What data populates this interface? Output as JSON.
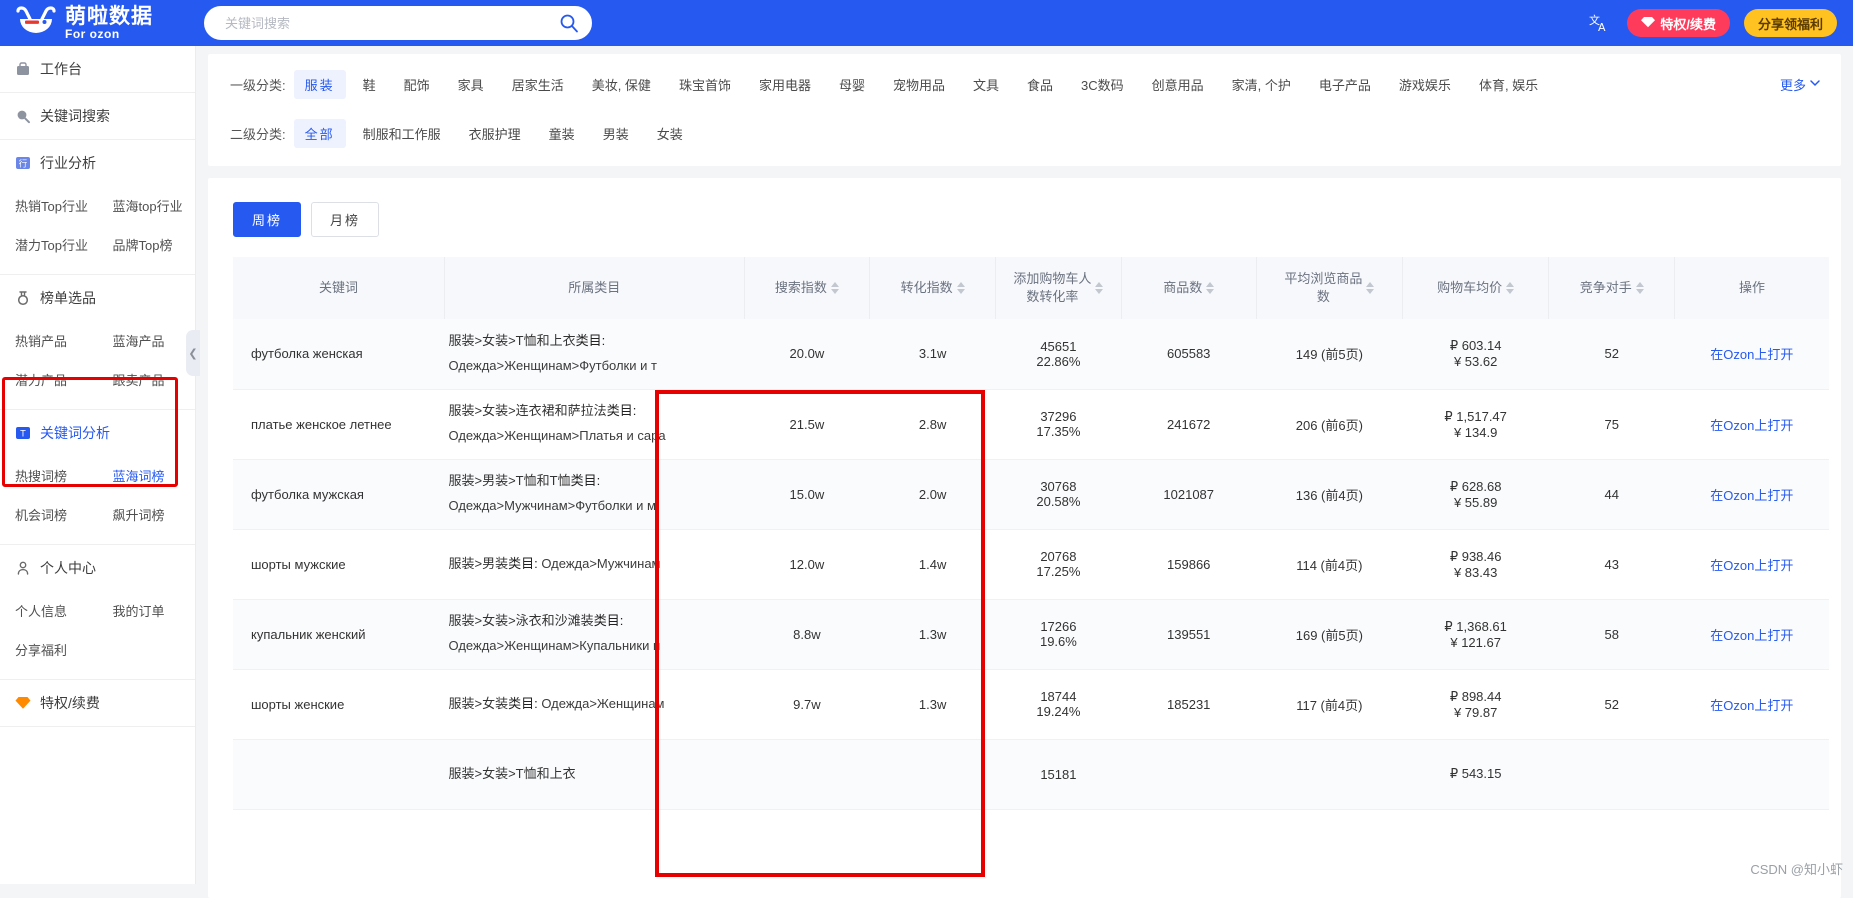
{
  "brand": {
    "name": "萌啦数据",
    "sub": "For ozon",
    "logo_icon": "smiley-logo-icon"
  },
  "search": {
    "placeholder": "关键词搜索",
    "value": "",
    "icon": "search-icon"
  },
  "topbar": {
    "lang_icon": "language-icon",
    "privilege_label": "特权/续费",
    "privilege_icon": "diamond-icon",
    "share_label": "分享领福利"
  },
  "sidebar": {
    "groups": [
      {
        "icon": "workbench-icon",
        "label": "工作台",
        "active": false,
        "items": []
      },
      {
        "icon": "search-icon",
        "label": "关键词搜索",
        "active": false,
        "items": []
      },
      {
        "icon": "industry-icon",
        "label": "行业分析",
        "active": false,
        "items": [
          {
            "label": "热销Top行业",
            "on": false
          },
          {
            "label": "蓝海top行业",
            "on": false
          },
          {
            "label": "潜力Top行业",
            "on": false
          },
          {
            "label": "品牌Top榜",
            "on": false
          }
        ]
      },
      {
        "icon": "medal-icon",
        "label": "榜单选品",
        "active": false,
        "items": [
          {
            "label": "热销产品",
            "on": false
          },
          {
            "label": "蓝海产品",
            "on": false
          },
          {
            "label": "潜力产品",
            "on": false
          },
          {
            "label": "跟卖产品",
            "on": false
          }
        ]
      },
      {
        "icon": "keyword-icon",
        "label": "关键词分析",
        "active": true,
        "items": [
          {
            "label": "热搜词榜",
            "on": false
          },
          {
            "label": "蓝海词榜",
            "on": true
          },
          {
            "label": "机会词榜",
            "on": false
          },
          {
            "label": "飙升词榜",
            "on": false
          }
        ]
      },
      {
        "icon": "user-icon",
        "label": "个人中心",
        "active": false,
        "items": [
          {
            "label": "个人信息",
            "on": false
          },
          {
            "label": "我的订单",
            "on": false
          },
          {
            "label": "分享福利",
            "on": false
          }
        ]
      },
      {
        "icon": "privilege-icon",
        "label": "特权/续费",
        "active": false,
        "items": []
      }
    ],
    "collapse_icon": "chevron-left-icon"
  },
  "filters": {
    "level1": {
      "label": "一级分类:",
      "selected": "服装",
      "options": [
        "服装",
        "鞋",
        "配饰",
        "家具",
        "居家生活",
        "美妆, 保健",
        "珠宝首饰",
        "家用电器",
        "母婴",
        "宠物用品",
        "文具",
        "食品",
        "3C数码",
        "创意用品",
        "家清, 个护",
        "电子产品",
        "游戏娱乐",
        "体育, 娱乐"
      ],
      "more_label": "更多",
      "more_icon": "chevron-down-icon"
    },
    "level2": {
      "label": "二级分类:",
      "selected": "全部",
      "options": [
        "全部",
        "制服和工作服",
        "衣服护理",
        "童装",
        "男装",
        "女装"
      ]
    }
  },
  "table": {
    "tabs": [
      {
        "label": "周榜",
        "active": true
      },
      {
        "label": "月榜",
        "active": false
      }
    ],
    "columns": [
      {
        "label": "关键词",
        "sortable": false
      },
      {
        "label": "所属类目",
        "sortable": false
      },
      {
        "label": "搜索指数",
        "sortable": true
      },
      {
        "label": "转化指数",
        "sortable": true
      },
      {
        "label": "添加购物车人数转化率",
        "sortable": true
      },
      {
        "label": "商品数",
        "sortable": true
      },
      {
        "label": "平均浏览商品数",
        "sortable": true
      },
      {
        "label": "购物车均价",
        "sortable": true
      },
      {
        "label": "竞争对手",
        "sortable": true
      },
      {
        "label": "操作",
        "sortable": false
      }
    ],
    "category_prefix": "类目:",
    "action_label": "在Ozon上打开",
    "rows": [
      {
        "keyword": "футболка женская",
        "cat_cn": "服装>女装>T恤和上衣",
        "cat_ru": "Одежда>Женщинам>Футболки и т",
        "search_index": "20.0w",
        "conv_index": "3.1w",
        "cart_count": "45651",
        "cart_rate": "22.86%",
        "goods_count": "605583",
        "avg_browse": "149 (前5页)",
        "cart_price_rub": "₽ 603.14",
        "cart_price_cny": "¥ 53.62",
        "competitors": "52"
      },
      {
        "keyword": "платье женское летнее",
        "cat_cn": "服装>女装>连衣裙和萨拉法",
        "cat_ru": "Одежда>Женщинам>Платья и сара",
        "search_index": "21.5w",
        "conv_index": "2.8w",
        "cart_count": "37296",
        "cart_rate": "17.35%",
        "goods_count": "241672",
        "avg_browse": "206 (前6页)",
        "cart_price_rub": "₽ 1,517.47",
        "cart_price_cny": "¥ 134.9",
        "competitors": "75"
      },
      {
        "keyword": "футболка мужская",
        "cat_cn": "服装>男装>T恤和T恤",
        "cat_ru": "Одежда>Мужчинам>Футболки и м",
        "search_index": "15.0w",
        "conv_index": "2.0w",
        "cart_count": "30768",
        "cart_rate": "20.58%",
        "goods_count": "1021087",
        "avg_browse": "136 (前4页)",
        "cart_price_rub": "₽ 628.68",
        "cart_price_cny": "¥ 55.89",
        "competitors": "44"
      },
      {
        "keyword": "шорты мужские",
        "cat_cn": "服装>男装",
        "cat_ru": "Одежда>Мужчинам",
        "search_index": "12.0w",
        "conv_index": "1.4w",
        "cart_count": "20768",
        "cart_rate": "17.25%",
        "goods_count": "159866",
        "avg_browse": "114 (前4页)",
        "cart_price_rub": "₽ 938.46",
        "cart_price_cny": "¥ 83.43",
        "competitors": "43"
      },
      {
        "keyword": "купальник женский",
        "cat_cn": "服装>女装>泳衣和沙滩装",
        "cat_ru": "Одежда>Женщинам>Купальники и",
        "search_index": "8.8w",
        "conv_index": "1.3w",
        "cart_count": "17266",
        "cart_rate": "19.6%",
        "goods_count": "139551",
        "avg_browse": "169 (前5页)",
        "cart_price_rub": "₽ 1,368.61",
        "cart_price_cny": "¥ 121.67",
        "competitors": "58"
      },
      {
        "keyword": "шорты женские",
        "cat_cn": "服装>女装",
        "cat_ru": "Одежда>Женщинам",
        "search_index": "9.7w",
        "conv_index": "1.3w",
        "cart_count": "18744",
        "cart_rate": "19.24%",
        "goods_count": "185231",
        "avg_browse": "117 (前4页)",
        "cart_price_rub": "₽ 898.44",
        "cart_price_cny": "¥ 79.87",
        "competitors": "52"
      },
      {
        "keyword": "",
        "cat_cn": "服装>女装>T恤和上衣",
        "cat_ru": "",
        "search_index": "",
        "conv_index": "",
        "cart_count": "15181",
        "cart_rate": "",
        "goods_count": "",
        "avg_browse": "",
        "cart_price_rub": "₽ 543.15",
        "cart_price_cny": "",
        "competitors": ""
      }
    ]
  },
  "watermark": "CSDN @知小虾",
  "colors": {
    "brand_blue": "#2659f0",
    "highlight_red": "#e60000",
    "accent_yellow": "#ffc220",
    "accent_pink": "#ff3b5c"
  }
}
